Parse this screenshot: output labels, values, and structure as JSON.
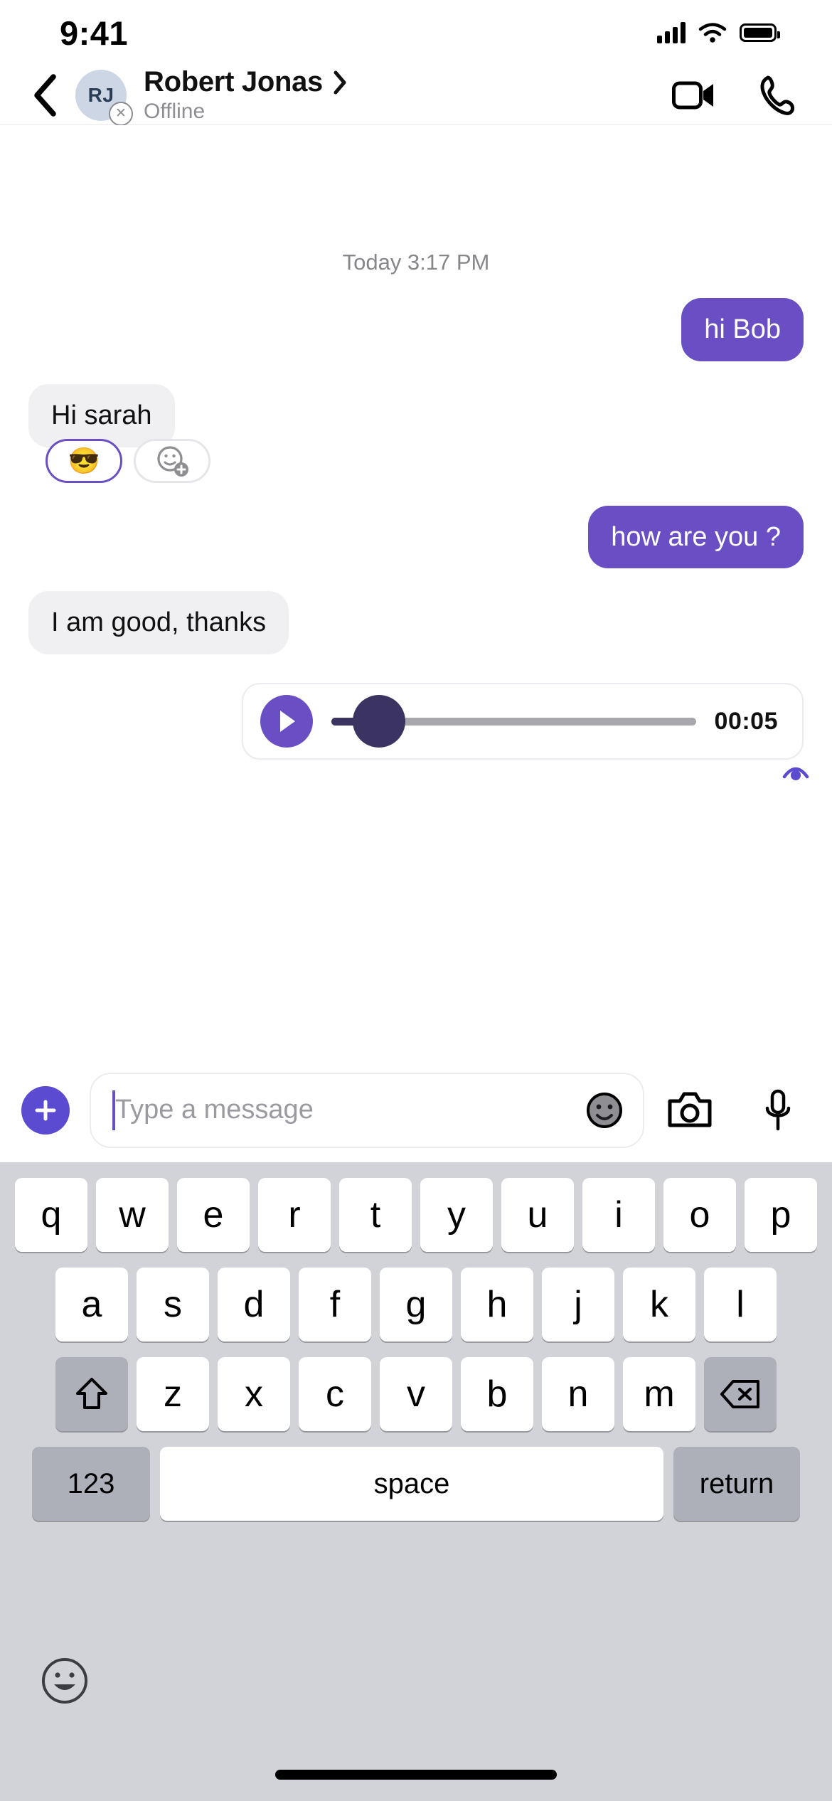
{
  "status_bar": {
    "time": "9:41",
    "signal_icon": "cellular-signal-icon",
    "wifi_icon": "wifi-icon",
    "battery_icon": "battery-full-icon"
  },
  "header": {
    "back_icon": "chevron-left-icon",
    "avatar_initials": "RJ",
    "presence_icon": "offline-badge-icon",
    "peer_name": "Robert Jonas",
    "disclosure_icon": "chevron-right-icon",
    "peer_status": "Offline",
    "video_call_icon": "video-camera-icon",
    "voice_call_icon": "phone-icon",
    "avatar_bg": "#ccd6e5"
  },
  "conversation": {
    "daystamp": "Today 3:17 PM",
    "accent_color": "#6a4fc4",
    "incoming_bubble_color": "#f0f0f3",
    "messages": [
      {
        "id": "m1",
        "direction": "out",
        "text": "hi Bob"
      },
      {
        "id": "m2",
        "direction": "in",
        "text": "Hi sarah"
      },
      {
        "id": "m3",
        "direction": "out",
        "text": "how are you ?"
      },
      {
        "id": "m4",
        "direction": "in",
        "text": "I am good, thanks"
      }
    ],
    "reactions": [
      {
        "emoji": "😎",
        "name": "sunglasses-reaction",
        "selected": true
      },
      {
        "emoji": "",
        "name": "add-reaction-icon",
        "selected": false
      }
    ],
    "audio_message": {
      "play_icon": "play-icon",
      "duration": "00:05",
      "progress_percent": 6,
      "thumb_color": "#3b3362",
      "track_color": "#a7a7ad",
      "seen_icon": "seen-eye-icon"
    }
  },
  "input_bar": {
    "add_icon": "plus-icon",
    "input_value": "",
    "placeholder": "Type a message",
    "emoji_icon": "smiley-icon",
    "camera_icon": "camera-icon",
    "mic_icon": "microphone-icon"
  },
  "keyboard": {
    "row1": [
      "q",
      "w",
      "e",
      "r",
      "t",
      "y",
      "u",
      "i",
      "o",
      "p"
    ],
    "row2": [
      "a",
      "s",
      "d",
      "f",
      "g",
      "h",
      "j",
      "k",
      "l"
    ],
    "row3": [
      "z",
      "x",
      "c",
      "v",
      "b",
      "n",
      "m"
    ],
    "shift_icon": "shift-icon",
    "backspace_icon": "backspace-icon",
    "numbers_label": "123",
    "space_label": "space",
    "return_label": "return",
    "emoji_picker_icon": "emoji-picker-icon"
  }
}
